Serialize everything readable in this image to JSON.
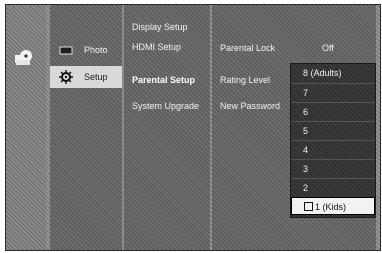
{
  "left_menu": [
    {
      "label": "Photo",
      "icon": "photo-icon"
    },
    {
      "label": "Setup",
      "icon": "setup-gear-icon",
      "active": true
    }
  ],
  "submenu": [
    "Display Setup",
    "HDMI Setup",
    "Parental Setup",
    "System Upgrade"
  ],
  "settings": {
    "parental_lock": {
      "label": "Parental Lock",
      "value": "Off"
    },
    "rating_level": {
      "label": "Rating Level"
    },
    "new_password": {
      "label": "New Password"
    }
  },
  "rating_options": [
    "8 (Adults)",
    "7",
    "6",
    "5",
    "4",
    "3",
    "2",
    "1 (Kids)"
  ],
  "selected_rating": "1 (Kids)",
  "colors": {
    "highlight": "#d9d9d9",
    "dropdown_bg": "#303030",
    "text": "#f4f4f4"
  }
}
